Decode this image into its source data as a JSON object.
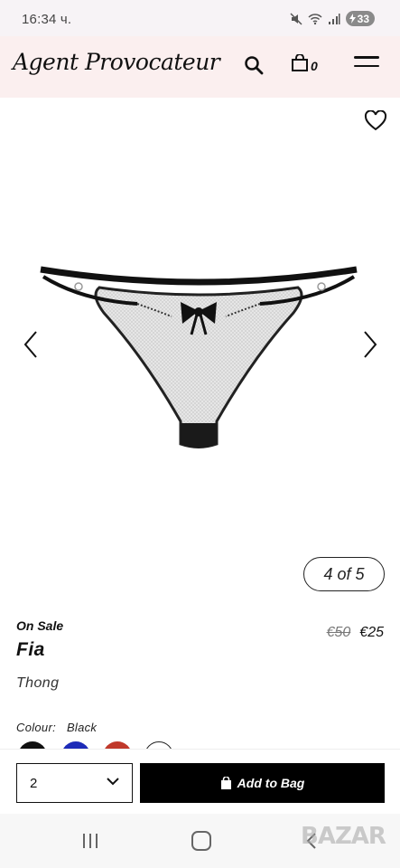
{
  "status_bar": {
    "time": "16:34 ч.",
    "battery": "33"
  },
  "header": {
    "brand": "Agent Provocateur",
    "bag_count": "0"
  },
  "gallery": {
    "counter": "4 of 5"
  },
  "product": {
    "sale_label": "On Sale",
    "name": "Fia",
    "type": "Thong",
    "old_price": "€50",
    "new_price": "€25",
    "colour_label": "Colour:",
    "colour_value": "Black",
    "swatch_colors": [
      "#111111",
      "#1d2bb8",
      "#c0392b",
      "#ffffff"
    ]
  },
  "purchase": {
    "quantity": "2",
    "add_label": "Add to Bag"
  },
  "watermark": "BAZAR"
}
